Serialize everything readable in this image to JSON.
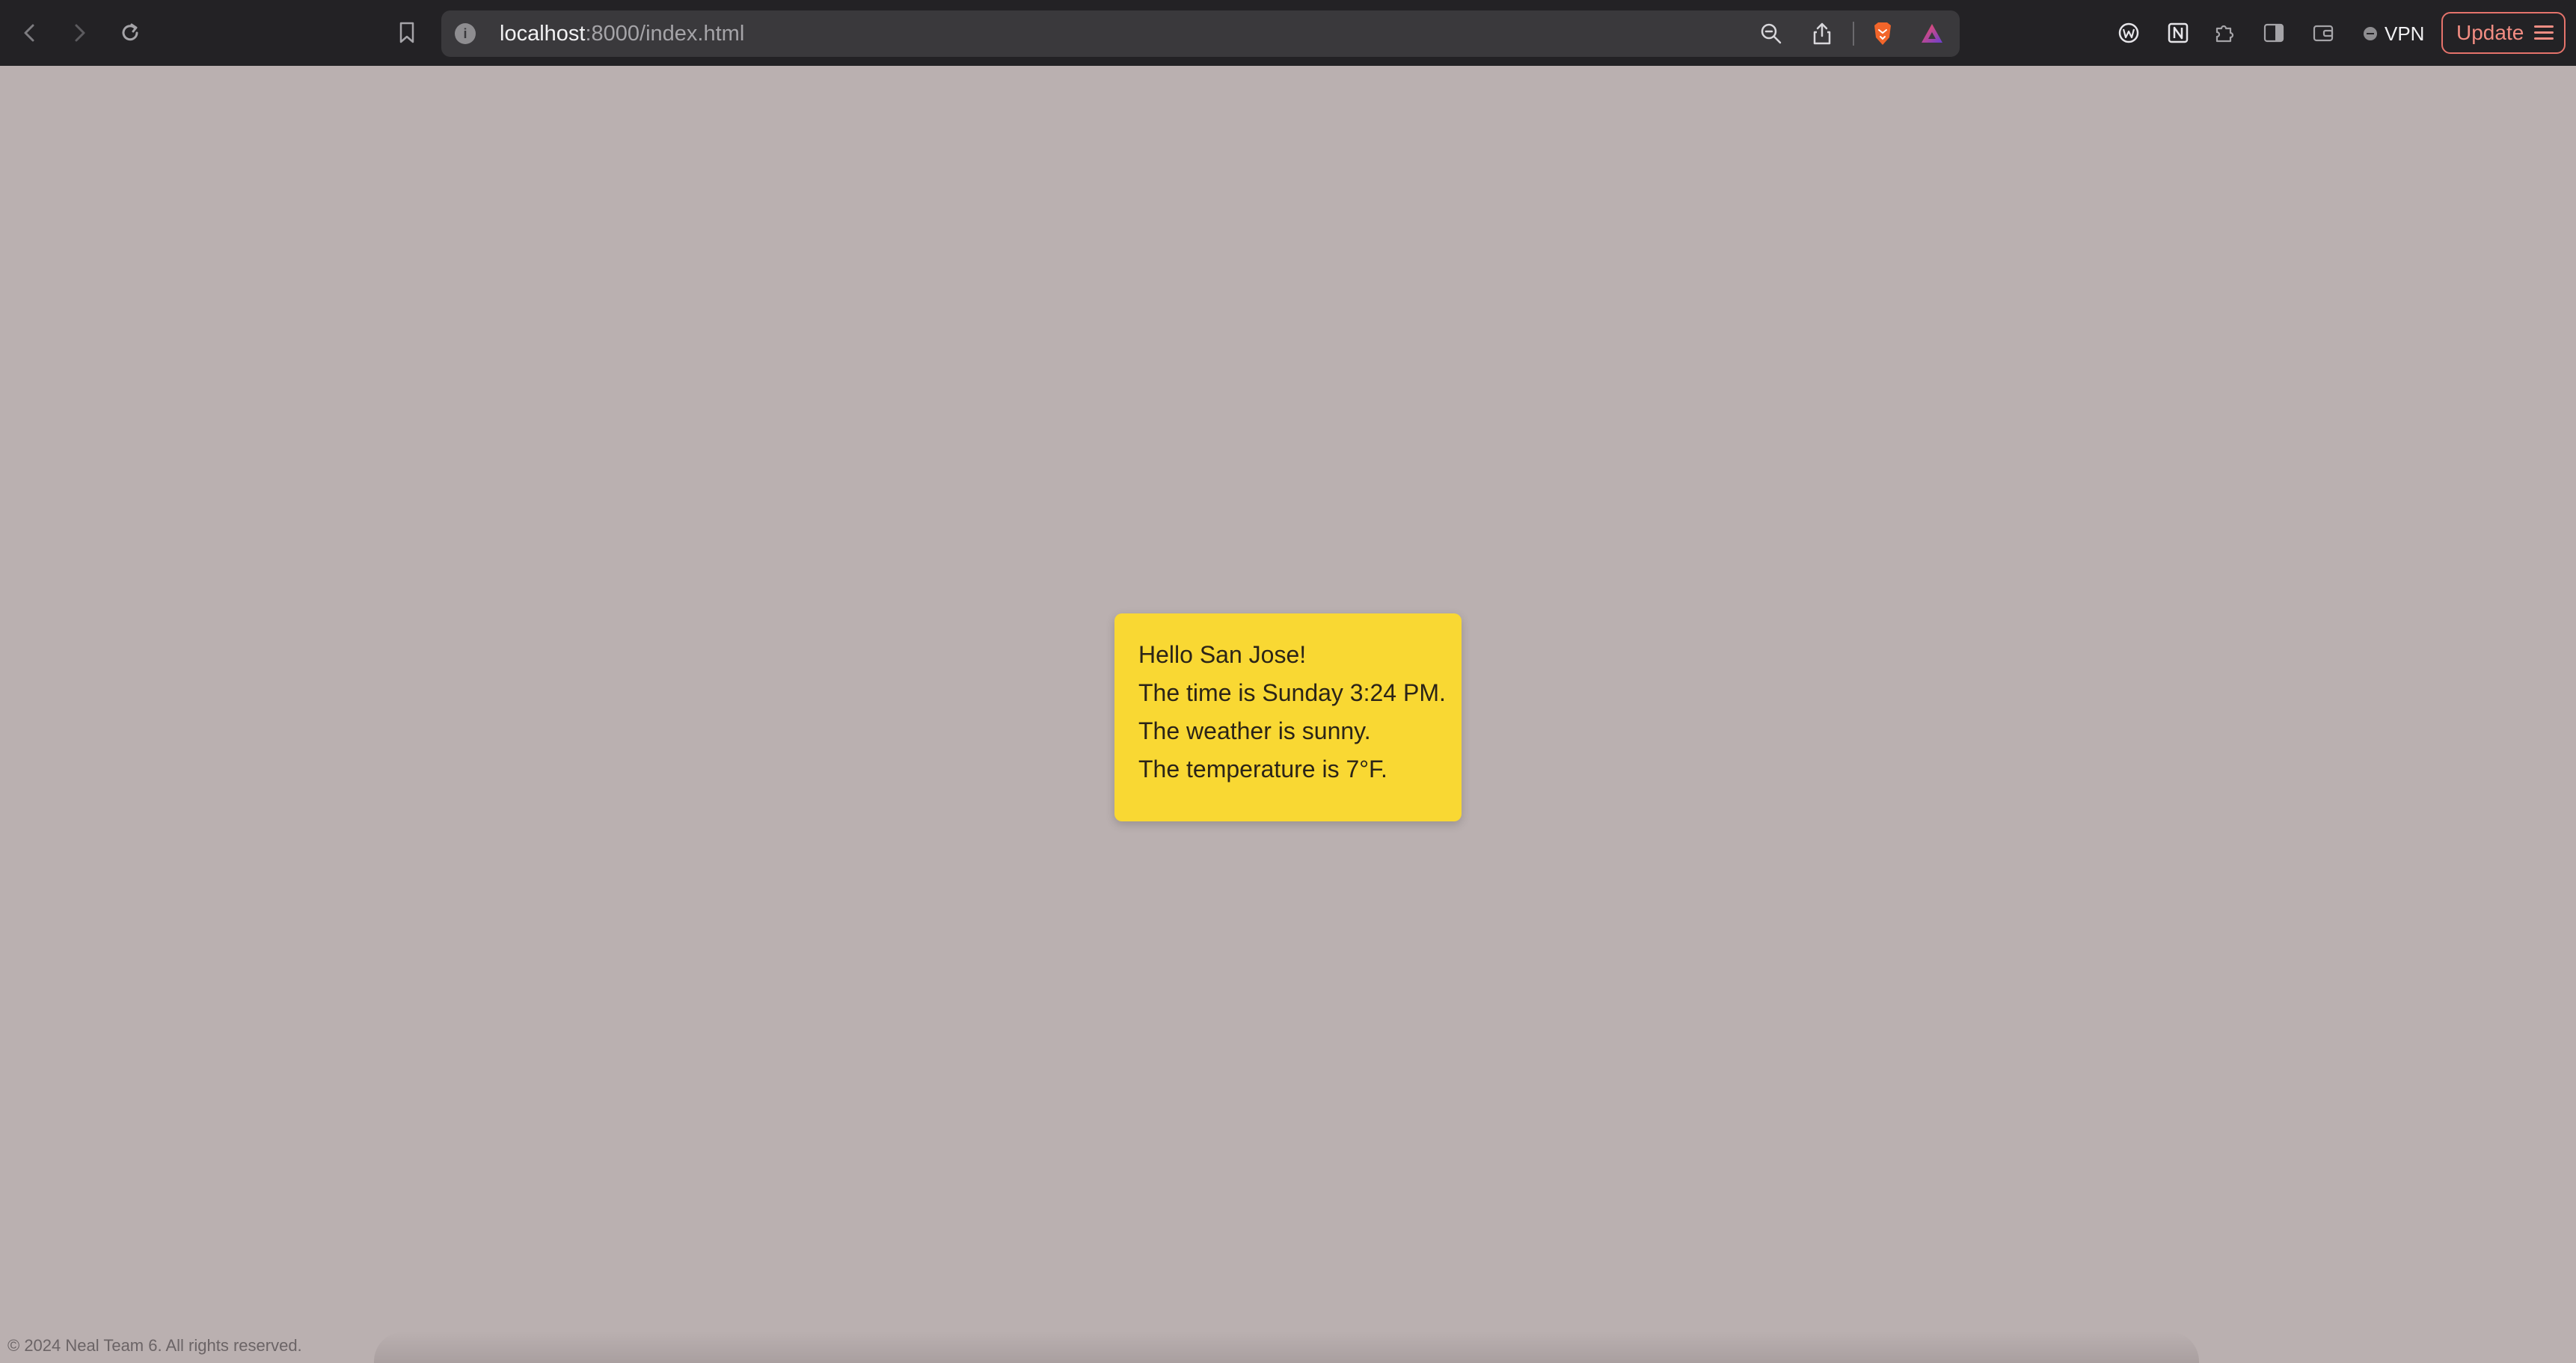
{
  "browser": {
    "url_host": "localhost",
    "url_path": ":8000/index.html",
    "vpn_label": "VPN",
    "update_label": "Update",
    "accent_color": "#e5736b"
  },
  "card": {
    "line1": "Hello San Jose!",
    "line2": "The time is Sunday 3:24 PM.",
    "line3": "The weather is sunny.",
    "line4": "The temperature is 7°F.",
    "background_color": "#f9d833"
  },
  "footer": {
    "copyright": "© 2024 Neal Team 6. All rights reserved."
  },
  "page": {
    "background_color": "#bab0b0"
  }
}
